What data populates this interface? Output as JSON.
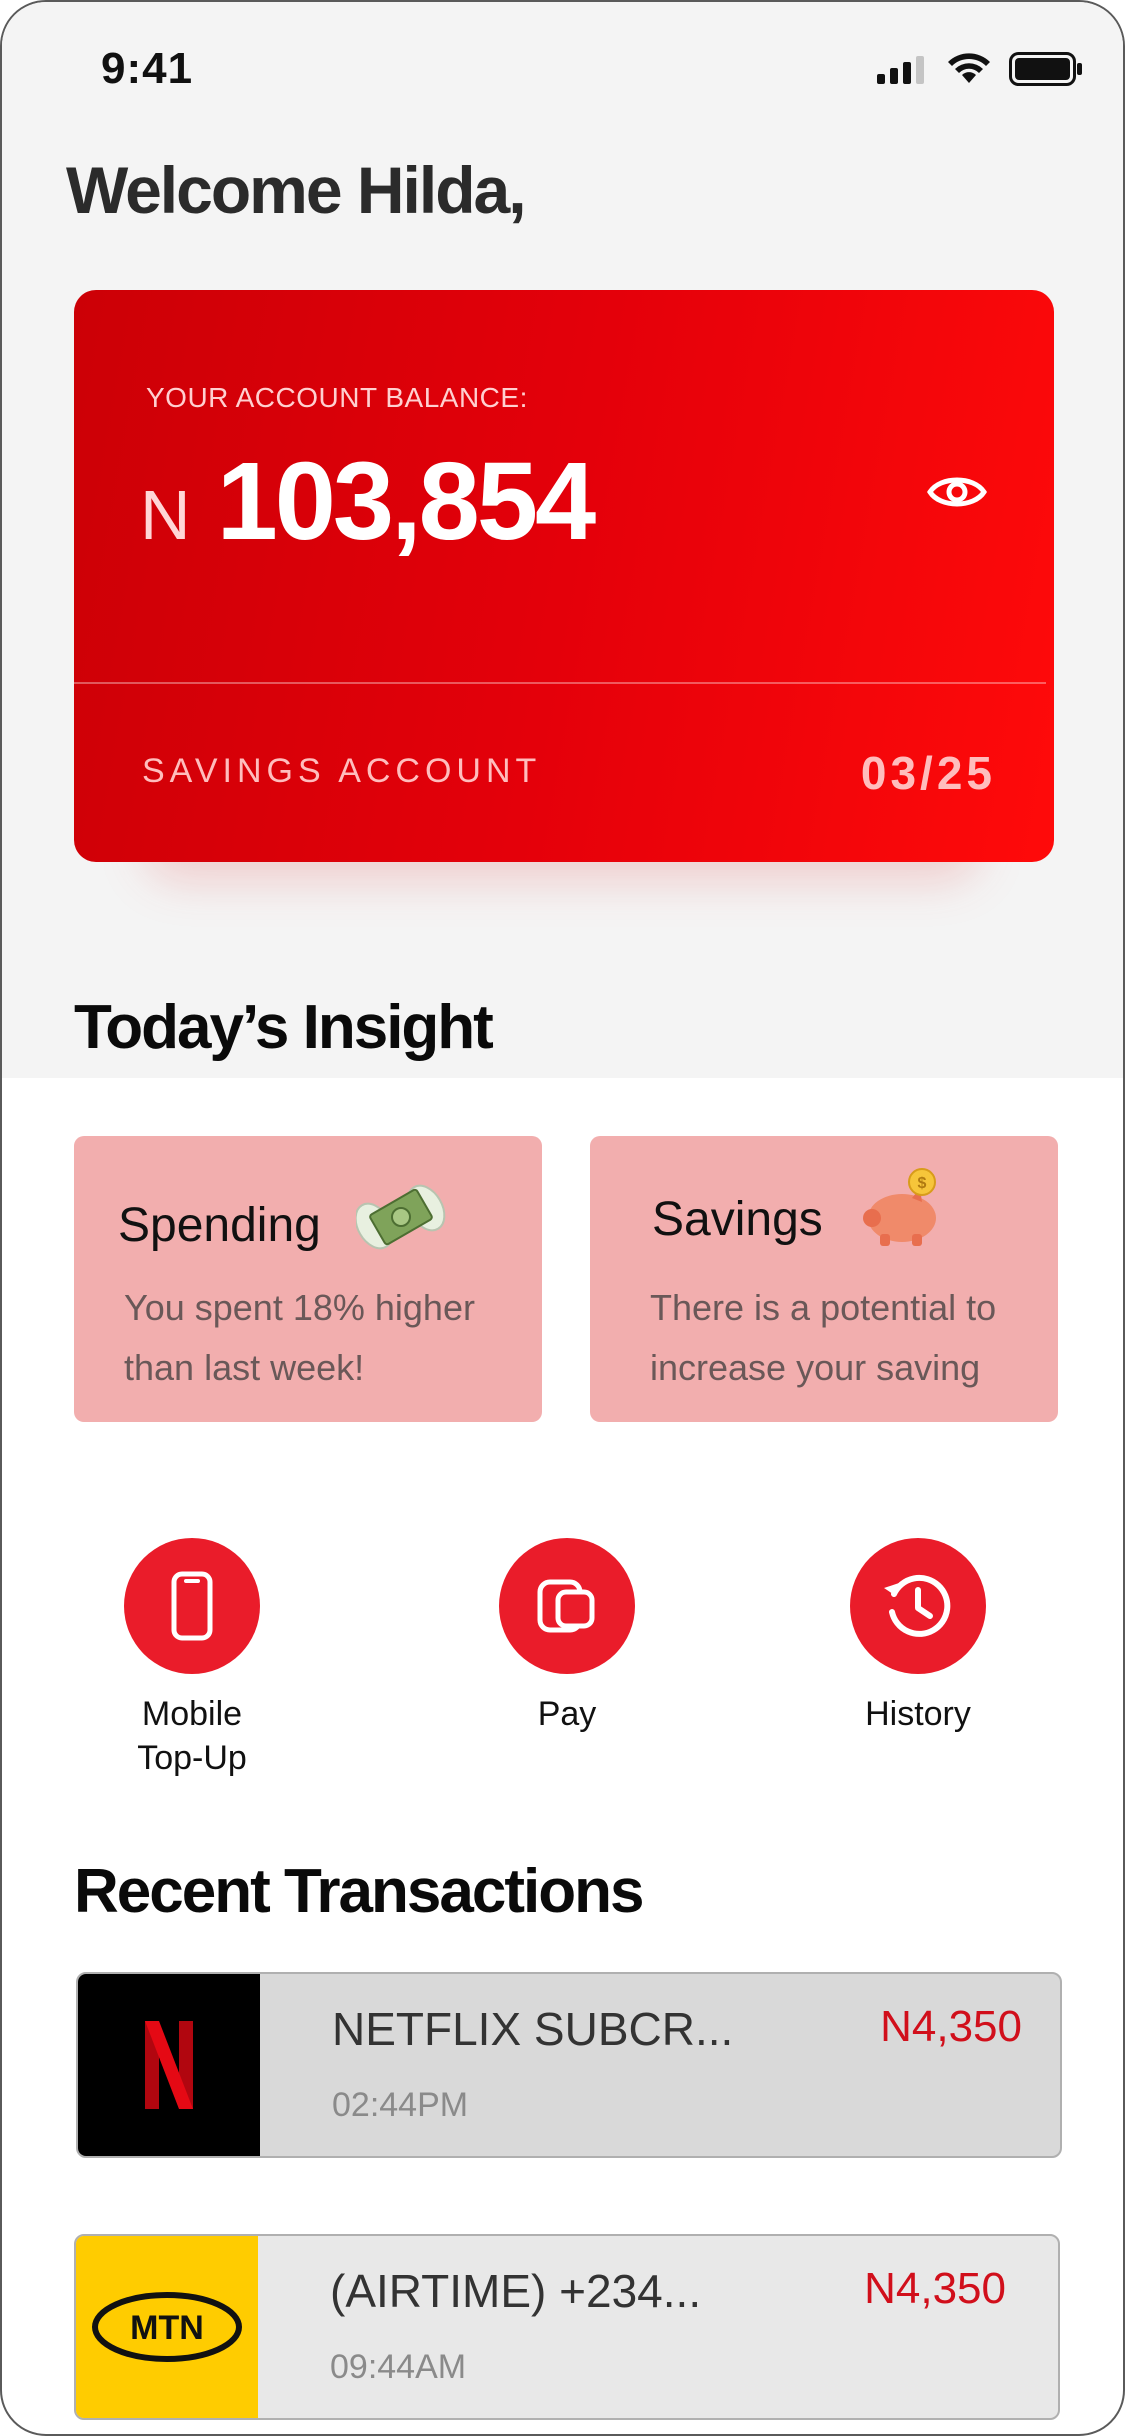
{
  "status_bar": {
    "time": "9:41",
    "icons": [
      "signal-icon",
      "wifi-icon",
      "battery-icon"
    ]
  },
  "greeting": "Welcome Hilda,",
  "balance_card": {
    "label": "YOUR ACCOUNT BALANCE:",
    "currency": "N",
    "amount": "103,854",
    "account_type": "SAVINGS ACCOUNT",
    "expiry": "03/25",
    "icon": "eye-icon"
  },
  "insight": {
    "title": "Today’s Insight",
    "cards": [
      {
        "title": "Spending",
        "text_line1": "You spent 18% higher",
        "text_line2": "than last week!",
        "icon": "money-wings-icon"
      },
      {
        "title": "Savings",
        "text_line1": "There is a potential to",
        "text_line2": "increase your saving",
        "icon": "piggy-bank-icon"
      }
    ]
  },
  "actions": [
    {
      "label_line1": "Mobile",
      "label_line2": "Top-Up",
      "icon": "mobile-phone-icon"
    },
    {
      "label_line1": "Pay",
      "label_line2": "",
      "icon": "pay-cards-icon"
    },
    {
      "label_line1": "History",
      "label_line2": "",
      "icon": "history-clock-icon"
    }
  ],
  "recent": {
    "title": "Recent Transactions",
    "items": [
      {
        "name": "NETFLIX SUBCR...",
        "time": "02:44PM",
        "amount": "N4,350",
        "logo": "netflix-logo",
        "logo_text": "N",
        "logo_bg": "#000000",
        "row_bg": "#d9d9d9"
      },
      {
        "name": "(AIRTIME) +234...",
        "time": "09:44AM",
        "amount": "N4,350",
        "logo": "mtn-logo",
        "logo_text": "MTN",
        "logo_bg": "#ffcc00",
        "row_bg": "#e8e8e8"
      }
    ]
  },
  "colors": {
    "accent": "#ea1c2a",
    "card_red": "#e4000a",
    "insight_card": "#f2aeae",
    "amount_red": "#d10f1b"
  }
}
